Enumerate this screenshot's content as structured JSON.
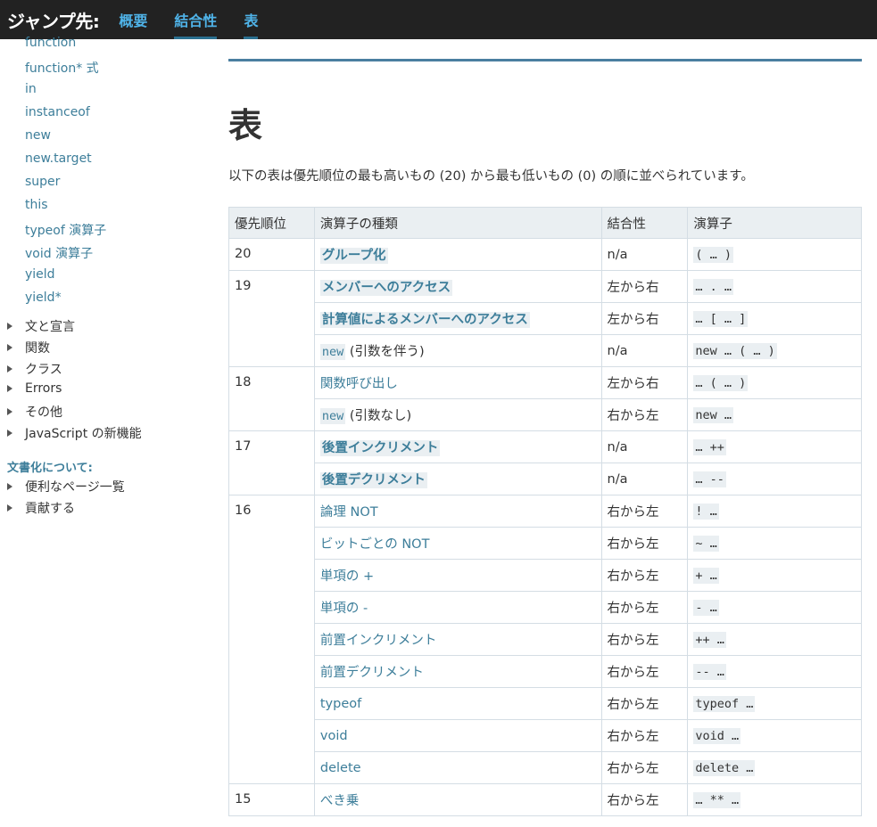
{
  "jumpbar": {
    "label": "ジャンプ先:",
    "links": [
      "概要",
      "結合性",
      "表"
    ]
  },
  "sidebar": {
    "links": [
      "function",
      "function* 式",
      "in",
      "instanceof",
      "new",
      "new.target",
      "super",
      "this",
      "typeof 演算子",
      "void 演算子",
      "yield",
      "yield*"
    ],
    "groups": [
      "文と宣言",
      "関数",
      "クラス",
      "Errors",
      "その他",
      "JavaScript の新機能"
    ],
    "heading": "文書化について:",
    "groups2": [
      "便利なページ一覧",
      "貢献する"
    ]
  },
  "main": {
    "title": "表",
    "intro": "以下の表は優先順位の最も高いもの (20) から最も低いもの (0) の順に並べられています。",
    "table": {
      "headers": [
        "優先順位",
        "演算子の種類",
        "結合性",
        "演算子"
      ],
      "rows": [
        {
          "prec": "20",
          "type": "グループ化",
          "assoc": "n/a",
          "op": "( … )"
        },
        {
          "prec": "19",
          "type": "メンバーへのアクセス",
          "assoc": "左から右",
          "op": "… . …"
        },
        {
          "type": "計算値によるメンバーへのアクセス",
          "assoc": "左から右",
          "op": "… [ … ]"
        },
        {
          "type_code": "new",
          "type": " (引数を伴う)",
          "assoc": "n/a",
          "op": "new … ( … )"
        },
        {
          "prec": "18",
          "type": "関数呼び出し",
          "assoc": "左から右",
          "op": "… ( … )"
        },
        {
          "type_code": "new",
          "type": " (引数なし)",
          "assoc": "右から左",
          "op": "new …"
        },
        {
          "prec": "17",
          "type": "後置インクリメント",
          "assoc": "n/a",
          "op": "… ++"
        },
        {
          "type": "後置デクリメント",
          "assoc": "n/a",
          "op": "… --"
        },
        {
          "prec": "16",
          "type": "論理 NOT",
          "assoc": "右から左",
          "op": "! …"
        },
        {
          "type": "ビットごとの NOT",
          "assoc": "右から左",
          "op": "~ …"
        },
        {
          "type": "単項の +",
          "assoc": "右から左",
          "op": "+ …"
        },
        {
          "type": "単項の -",
          "assoc": "右から左",
          "op": "- …"
        },
        {
          "type": "前置インクリメント",
          "assoc": "右から左",
          "op": "++ …"
        },
        {
          "type": "前置デクリメント",
          "assoc": "右から左",
          "op": "-- …"
        },
        {
          "type": "typeof",
          "assoc": "右から左",
          "op": "typeof …"
        },
        {
          "type": "void",
          "assoc": "右から左",
          "op": "void …"
        },
        {
          "type": "delete",
          "assoc": "右から左",
          "op": "delete …"
        },
        {
          "prec": "15",
          "type": "べき乗",
          "assoc": "右から左",
          "op": "… ** …"
        }
      ]
    }
  }
}
